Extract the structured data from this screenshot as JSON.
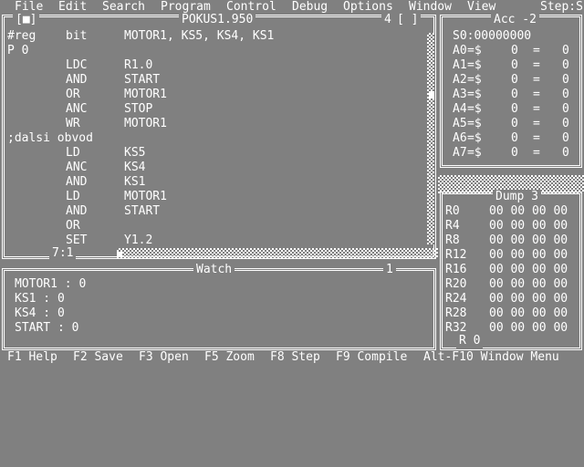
{
  "menu": [
    "File",
    "Edit",
    "Search",
    "Program",
    "Control",
    "Debug",
    "Options",
    "Window",
    "View",
    "Step:S"
  ],
  "editor": {
    "title": "POKUS1.950",
    "close_glyph": "[■]",
    "window_number": "4",
    "zoom_glyph": "[ ]",
    "position": "7:1",
    "lines": [
      {
        "label": "#reg",
        "op": "bit",
        "arg": "MOTOR1, KS5, KS4, KS1"
      },
      {
        "label": "P 0",
        "op": "",
        "arg": ""
      },
      {
        "label": "",
        "op": "LDC",
        "arg": "R1.0"
      },
      {
        "label": "",
        "op": "AND",
        "arg": "START"
      },
      {
        "label": "",
        "op": "OR",
        "arg": "MOTOR1"
      },
      {
        "label": "",
        "op": "ANC",
        "arg": "STOP"
      },
      {
        "label": "",
        "op": "WR",
        "arg": "MOTOR1"
      },
      {
        "label": ";dalsi obvod",
        "op": "",
        "arg": ""
      },
      {
        "label": "",
        "op": "LD",
        "arg": "KS5"
      },
      {
        "label": "",
        "op": "ANC",
        "arg": "KS4"
      },
      {
        "label": "",
        "op": "AND",
        "arg": "KS1"
      },
      {
        "label": "",
        "op": "LD",
        "arg": "MOTOR1"
      },
      {
        "label": "",
        "op": "AND",
        "arg": "START"
      },
      {
        "label": "",
        "op": "OR",
        "arg": ""
      },
      {
        "label": "",
        "op": "SET",
        "arg": "Y1.2"
      }
    ]
  },
  "acc": {
    "title": "Acc -2",
    "s0": "S0:00000000",
    "rows": [
      {
        "reg": "A0",
        "val": "=$",
        "eq": "=",
        "num": "0"
      },
      {
        "reg": "A1",
        "val": "=$",
        "eq": "=",
        "num": "0"
      },
      {
        "reg": "A2",
        "val": "=$",
        "eq": "=",
        "num": "0"
      },
      {
        "reg": "A3",
        "val": "=$",
        "eq": "=",
        "num": "0"
      },
      {
        "reg": "A4",
        "val": "=$",
        "eq": "=",
        "num": "0"
      },
      {
        "reg": "A5",
        "val": "=$",
        "eq": "=",
        "num": "0"
      },
      {
        "reg": "A6",
        "val": "=$",
        "eq": "=",
        "num": "0"
      },
      {
        "reg": "A7",
        "val": "=$",
        "eq": "=",
        "num": "0"
      }
    ],
    "zeros": [
      "0",
      "0",
      "0",
      "0",
      "0",
      "0",
      "0",
      "0"
    ]
  },
  "dump": {
    "title": "Dump 3",
    "rows": [
      {
        "reg": "R0",
        "bytes": "00 00 00 00"
      },
      {
        "reg": "R4",
        "bytes": "00 00 00 00"
      },
      {
        "reg": "R8",
        "bytes": "00 00 00 00"
      },
      {
        "reg": "R12",
        "bytes": "00 00 00 00"
      },
      {
        "reg": "R16",
        "bytes": "00 00 00 00"
      },
      {
        "reg": "R20",
        "bytes": "00 00 00 00"
      },
      {
        "reg": "R24",
        "bytes": "00 00 00 00"
      },
      {
        "reg": "R28",
        "bytes": "00 00 00 00"
      },
      {
        "reg": "R32",
        "bytes": "00 00 00 00"
      }
    ],
    "footer": "R 0"
  },
  "watch": {
    "title": "Watch",
    "window_number": "1",
    "items": [
      "MOTOR1 : 0",
      "KS1 : 0",
      "KS4 : 0",
      "START : 0"
    ]
  },
  "fkeys": [
    {
      "key": "F1",
      "label": "Help"
    },
    {
      "key": "F2",
      "label": "Save"
    },
    {
      "key": "F3",
      "label": "Open"
    },
    {
      "key": "F5",
      "label": "Zoom"
    },
    {
      "key": "F8",
      "label": "Step"
    },
    {
      "key": "F9",
      "label": "Compile"
    },
    {
      "key": "Alt-F10",
      "label": "Window Menu"
    }
  ]
}
